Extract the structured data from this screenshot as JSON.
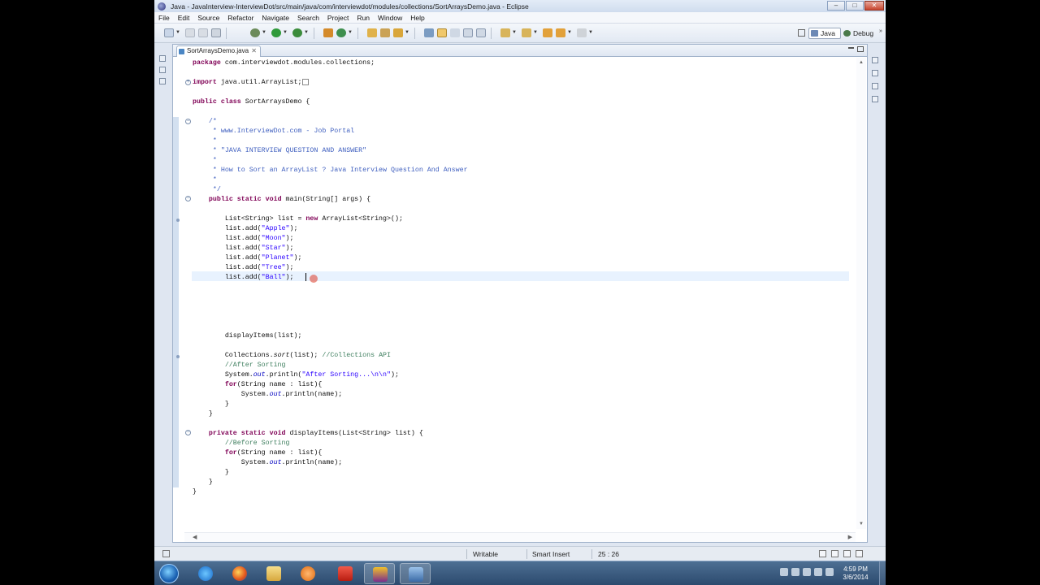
{
  "window": {
    "title": "Java - JavaInterview-InterviewDot/src/main/java/com/interviewdot/modules/collections/SortArraysDemo.java - Eclipse",
    "controls": [
      "minimize-icon",
      "maximize-icon",
      "close-icon"
    ]
  },
  "menu": [
    "File",
    "Edit",
    "Source",
    "Refactor",
    "Navigate",
    "Search",
    "Project",
    "Run",
    "Window",
    "Help"
  ],
  "perspectives": {
    "java": "Java",
    "debug": "Debug"
  },
  "editor": {
    "tab_label": "SortArraysDemo.java",
    "lines": {
      "l1": "package com.interviewdot.modules.collections;",
      "l2": "import java.util.ArrayList;",
      "l3": "public class SortArraysDemo {",
      "l4": "    /*",
      "l5": "     * www.InterviewDot.com - Job Portal",
      "l6": "     *",
      "l7": "     * \"JAVA INTERVIEW QUESTION AND ANSWER\"",
      "l8": "     *",
      "l9": "     * How to Sort an ArrayList ? Java Interview Question And Answer",
      "l10": "     *",
      "l11": "     */",
      "l12": "    public static void main(String[] args) {",
      "l13": "        List<String> list = new ArrayList<String>();",
      "l14": "        list.add(\"Apple\");",
      "l15": "        list.add(\"Moon\");",
      "l16": "        list.add(\"Star\");",
      "l17": "        list.add(\"Planet\");",
      "l18": "        list.add(\"Tree\");",
      "l19": "        list.add(\"Ball\");",
      "l20": "        displayItems(list);",
      "l21": "        Collections.sort(list); //Collections API",
      "l22": "        //After Sorting",
      "l23": "        System.out.println(\"After Sorting...\\n\\n\");",
      "l24": "        for(String name : list){",
      "l25": "            System.out.println(name);",
      "l26": "        }",
      "l27": "    }",
      "l28": "    private static void displayItems(List<String> list) {",
      "l29": "        //Before Sorting",
      "l30": "        for(String name : list){",
      "l31": "            System.out.println(name);",
      "l32": "        }",
      "l33": "    }",
      "l34": "}"
    }
  },
  "status": {
    "writable": "Writable",
    "insert_mode": "Smart Insert",
    "position": "25 : 26"
  },
  "taskbar": {
    "time": "4:59 PM",
    "date": "3/6/2014",
    "apps": [
      "internet-explorer-icon",
      "firefox-icon",
      "file-explorer-icon",
      "media-player-icon",
      "acrobat-icon",
      "game-icon",
      "eclipse-icon"
    ]
  },
  "colors": {
    "keyword": "#7f0055",
    "comment": "#3f7f5f",
    "javadoc": "#3f5fbf",
    "string": "#2a00ff",
    "field": "#0000c0"
  }
}
